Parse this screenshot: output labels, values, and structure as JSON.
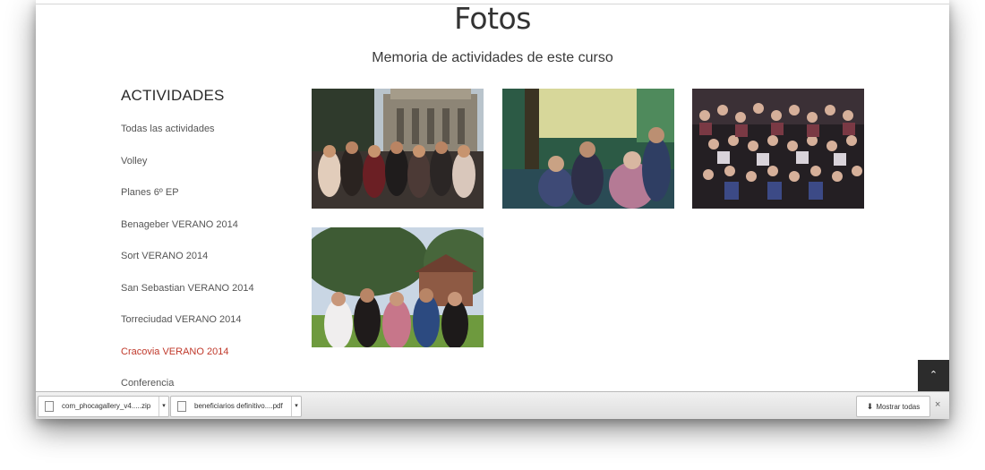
{
  "page": {
    "title": "Fotos",
    "subtitle": "Memoria de actividades de este curso"
  },
  "sidebar": {
    "heading": "ACTIVIDADES",
    "items": [
      {
        "label": "Todas las actividades",
        "active": false
      },
      {
        "label": "Volley",
        "active": false
      },
      {
        "label": "Planes 6º EP",
        "active": false
      },
      {
        "label": "Benageber VERANO 2014",
        "active": false
      },
      {
        "label": "Sort VERANO 2014",
        "active": false
      },
      {
        "label": "San Sebastian VERANO 2014",
        "active": false
      },
      {
        "label": "Torreciudad VERANO 2014",
        "active": false
      },
      {
        "label": "Cracovia VERANO 2014",
        "active": true
      },
      {
        "label": "Conferencia",
        "active": false
      }
    ],
    "active_color": "#c0392b"
  },
  "gallery": {
    "photos": [
      {
        "icon": "photo-thumbnail"
      },
      {
        "icon": "photo-thumbnail"
      },
      {
        "icon": "photo-thumbnail"
      },
      {
        "icon": "photo-thumbnail"
      }
    ]
  },
  "back_to_top": {
    "icon": "chevron-up-icon",
    "glyph": "⌃"
  },
  "download_bar": {
    "downloads": [
      {
        "name": "com_phocagallery_v4.....zip",
        "menu_glyph": "▾"
      },
      {
        "name": "beneficiarios definitivo....pdf",
        "menu_glyph": "▾"
      }
    ],
    "show_all_label": "Mostrar todas",
    "show_all_icon": "download-arrow-icon",
    "close_glyph": "×"
  }
}
